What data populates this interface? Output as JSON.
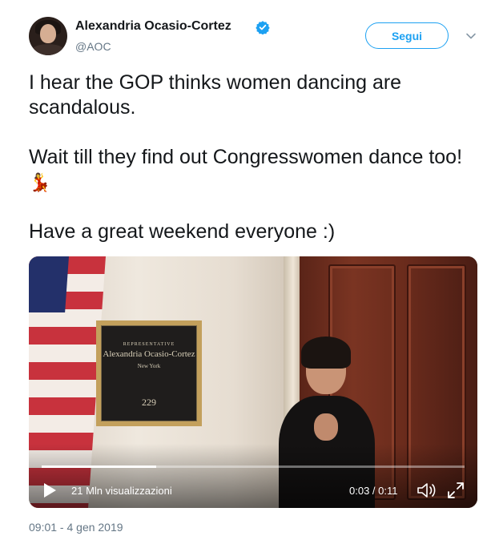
{
  "author": {
    "name": "Alexandria Ocasio-Cortez",
    "handle": "@AOC",
    "verified": true,
    "avatar_icon": "profile-photo"
  },
  "follow_button": {
    "label": "Segui",
    "color": "#1da1f2"
  },
  "more_menu": {
    "icon": "chevron-down-icon"
  },
  "tweet": {
    "paragraphs": [
      "I hear the GOP thinks women dancing are scandalous.",
      "Wait till they find out Congresswomen dance too! ",
      "Have a great weekend everyone :)"
    ],
    "emoji": "💃"
  },
  "video": {
    "views": "21 Mln visualizzazioni",
    "timecode": "0:03 / 0:11",
    "progress": 0.27,
    "plaque": {
      "title": "REPRESENTATIVE",
      "name": "Alexandria Ocasio-Cortez",
      "state": "New York",
      "room": "229"
    }
  },
  "timestamp": "09:01 - 4 gen 2019"
}
